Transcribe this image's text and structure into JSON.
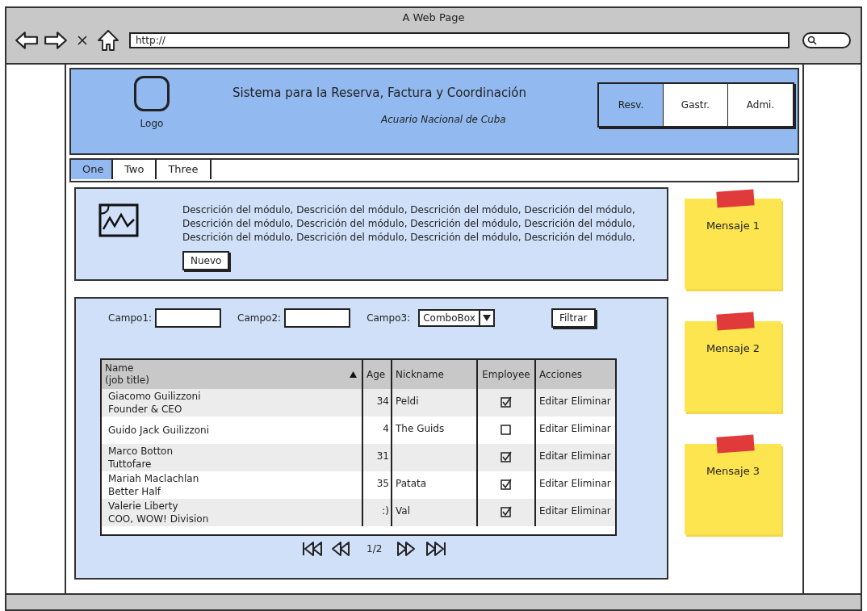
{
  "window": {
    "title": "A Web Page",
    "url": "http://"
  },
  "header": {
    "logo_label": "Logo",
    "title": "Sistema para la Reserva, Factura y Coordinación",
    "subtitle": "Acuario Nacional de Cuba",
    "nav": [
      {
        "label": "Resv.",
        "selected": true
      },
      {
        "label": "Gastr.",
        "selected": false
      },
      {
        "label": "Admi.",
        "selected": false
      }
    ]
  },
  "tabs": [
    {
      "label": "One",
      "selected": true
    },
    {
      "label": "Two",
      "selected": false
    },
    {
      "label": "Three",
      "selected": false
    }
  ],
  "description": {
    "lines": [
      "Descrición del módulo, Descrición del módulo, Descrición del módulo, Descrición del módulo,",
      "Descrición del módulo, Descrición del módulo, Descrición del módulo, Descrición del módulo,",
      "Descrición del módulo, Descrición del módulo, Descrición del módulo, Descrición del módulo,"
    ],
    "button": "Nuevo"
  },
  "filters": {
    "fields": [
      {
        "label": "Campo1:",
        "kind": "text"
      },
      {
        "label": "Campo2:",
        "kind": "text"
      },
      {
        "label": "Campo3:",
        "kind": "combo",
        "value": "ComboBox"
      }
    ],
    "button": "Filtrar"
  },
  "table": {
    "columns": [
      {
        "label": "Name",
        "sublabel": "(job title)",
        "sorted": true
      },
      {
        "label": "Age"
      },
      {
        "label": "Nickname"
      },
      {
        "label": "Employee"
      },
      {
        "label": "Acciones"
      }
    ],
    "rows": [
      {
        "name": "Giacomo Guilizzoni",
        "title": "Founder & CEO",
        "age": "34",
        "nickname": "Peldi",
        "employee": true,
        "actions": [
          "Editar",
          "Eliminar"
        ]
      },
      {
        "name": "Guido Jack Guilizzoni",
        "age": "4",
        "nickname": "The Guids",
        "employee": false,
        "actions": [
          "Editar",
          "Eliminar"
        ]
      },
      {
        "name": "Marco Botton",
        "title": "Tuttofare",
        "age": "31",
        "employee": true,
        "actions": [
          "Editar",
          "Eliminar"
        ]
      },
      {
        "name": "Mariah Maclachlan",
        "title": "Better Half",
        "age": "35",
        "nickname": "Patata",
        "employee": true,
        "actions": [
          "Editar",
          "Eliminar"
        ]
      },
      {
        "name": "Valerie Liberty",
        "title": "COO, WOW! Division",
        "age": ":)",
        "nickname": "Val",
        "employee": true,
        "actions": [
          "Editar",
          "Eliminar"
        ]
      }
    ]
  },
  "pager": {
    "page": "1/2"
  },
  "notes": [
    {
      "label": "Mensaje 1"
    },
    {
      "label": "Mensaje 2"
    },
    {
      "label": "Mensaje 3"
    }
  ]
}
